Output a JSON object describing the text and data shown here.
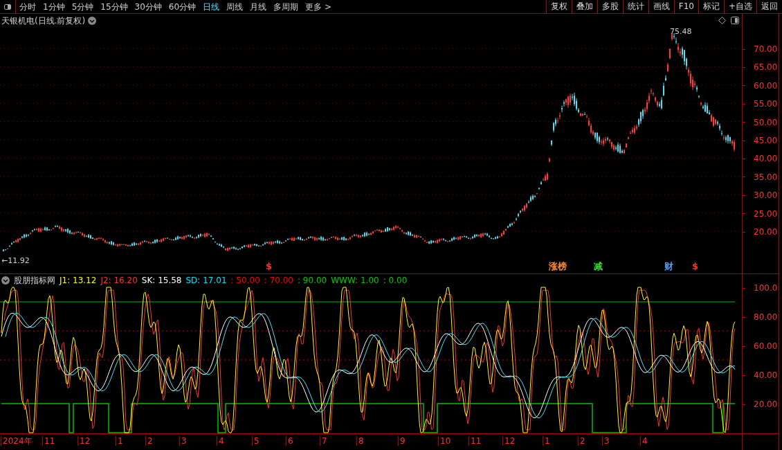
{
  "toolbar": {
    "periods": [
      {
        "label": "分时",
        "selected": false
      },
      {
        "label": "1分钟",
        "selected": false
      },
      {
        "label": "5分钟",
        "selected": false
      },
      {
        "label": "15分钟",
        "selected": false
      },
      {
        "label": "30分钟",
        "selected": false
      },
      {
        "label": "60分钟",
        "selected": false
      },
      {
        "label": "日线",
        "selected": true
      },
      {
        "label": "周线",
        "selected": false
      },
      {
        "label": "月线",
        "selected": false
      },
      {
        "label": "多周期",
        "selected": false
      },
      {
        "label": "更多 >",
        "selected": false
      }
    ],
    "buttons": [
      "复权",
      "叠加",
      "多股",
      "统计",
      "画线",
      "F10",
      "标记",
      "+自选",
      "返回"
    ]
  },
  "price_chart": {
    "title": "天银机电(日线.前复权)",
    "high_label": "75.48",
    "low_label": "←11.92",
    "y_ticks": [
      "70.00",
      "65.00",
      "60.00",
      "55.00",
      "50.00",
      "45.00",
      "40.00",
      "35.00",
      "30.00",
      "25.00",
      "20.00"
    ],
    "markers": [
      {
        "text": "$",
        "color": "#ff3030"
      },
      {
        "text": "涨榜",
        "color": "#ff9030"
      },
      {
        "text": "减",
        "color": "#30e030"
      },
      {
        "text": "财",
        "color": "#4aa0ff"
      },
      {
        "text": "$",
        "color": "#ff3030"
      }
    ]
  },
  "indicator": {
    "title": "股朋指标网",
    "values": [
      {
        "text": "J1: 13.12",
        "color": "#ffff00"
      },
      {
        "text": "J2: 16.20",
        "color": "#ff3030"
      },
      {
        "text": "SK: 15.58",
        "color": "#ffffff"
      },
      {
        "text": "SD: 17.01",
        "color": "#00e5ff"
      },
      {
        "text": ": 50.00",
        "color": "#ff0000"
      },
      {
        "text": ": 70.00",
        "color": "#ff0000"
      },
      {
        "text": ": 90.00",
        "color": "#00cc00"
      },
      {
        "text": "WWW: 1.00",
        "color": "#00cc00"
      },
      {
        "text": ": 0.00",
        "color": "#00cc00"
      }
    ],
    "y_ticks": [
      "100.0",
      "80.00",
      "60.00",
      "40.00",
      "20.00"
    ]
  },
  "date_axis": [
    "2024年",
    "11",
    "12",
    "1",
    "2",
    "3",
    "4",
    "5",
    "6",
    "7",
    "8",
    "9",
    "10",
    "11",
    "12",
    "1",
    "2",
    "3",
    "4"
  ]
}
